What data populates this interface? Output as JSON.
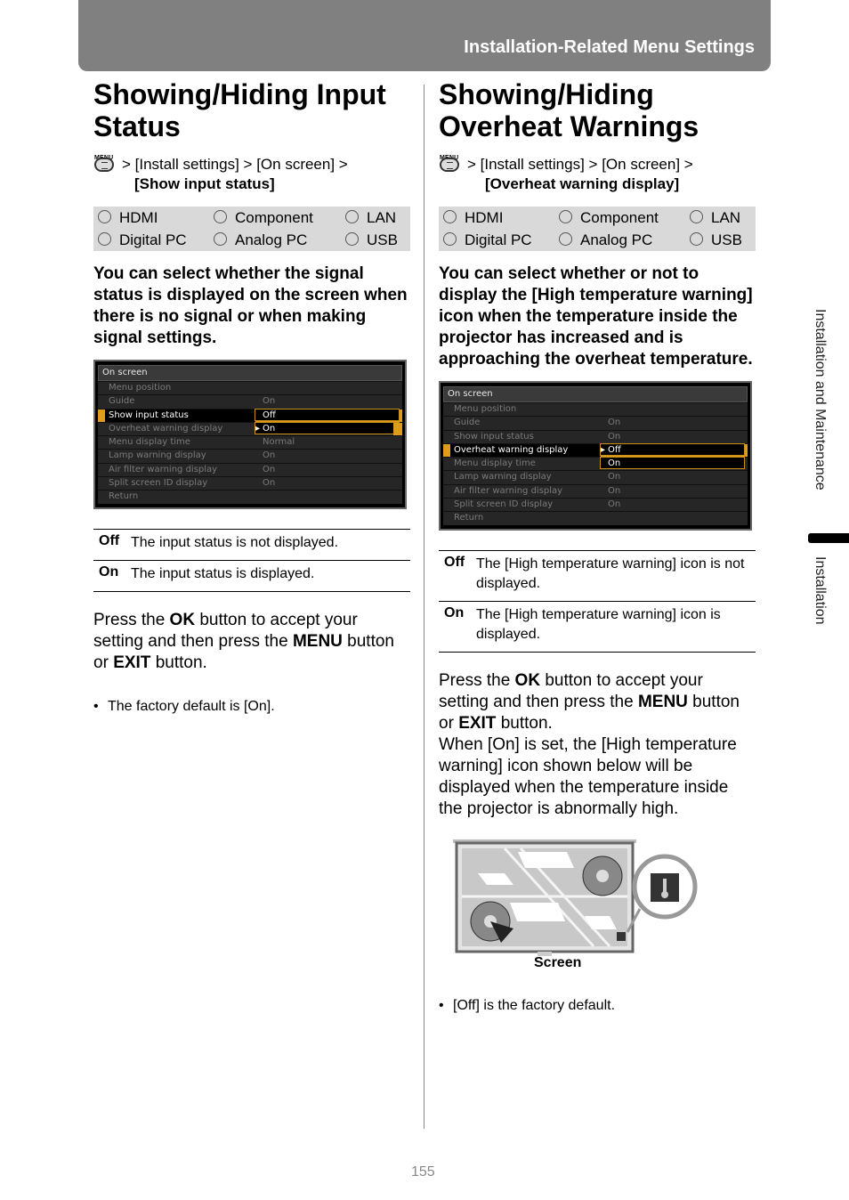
{
  "header": {
    "title": "Installation-Related Menu Settings"
  },
  "side_tabs": {
    "section": "Installation and Maintenance",
    "current": "Installation"
  },
  "page_number": "155",
  "left": {
    "title": "Showing/Hiding Input Status",
    "path_prefix": "> [Install settings] > [On screen] >",
    "path_target": "[Show input status]",
    "menu_icon_label": "MENU",
    "inputs": [
      "HDMI",
      "Component",
      "LAN",
      "Digital PC",
      "Analog PC",
      "USB"
    ],
    "lead": "You can select whether the signal status is displayed on the screen when there is no signal or when making signal settings.",
    "osd": {
      "title": "On screen",
      "rows": [
        {
          "name": "Menu position",
          "value": ""
        },
        {
          "name": "Guide",
          "value": "On"
        },
        {
          "name": "Show input status",
          "value": "Off"
        },
        {
          "name": "Overheat warning display",
          "value": "On"
        },
        {
          "name": "Menu display time",
          "value": "Normal"
        },
        {
          "name": "Lamp warning display",
          "value": "On"
        },
        {
          "name": "Air filter warning display",
          "value": "On"
        },
        {
          "name": "Split screen ID display",
          "value": "On"
        },
        {
          "name": "Return",
          "value": ""
        }
      ],
      "selected_item": "Show input status",
      "popup_options": [
        "Off",
        "On"
      ],
      "popup_cursor": "On"
    },
    "options": [
      {
        "key": "Off",
        "desc": "The input status is not displayed."
      },
      {
        "key": "On",
        "desc": "The input status is displayed."
      }
    ],
    "instruction": {
      "p1": "Press the ",
      "ok": "OK",
      "p2": " button to accept your setting and then press the ",
      "menu": "MENU",
      "p3": " button or ",
      "exit": "EXIT",
      "p4": " button."
    },
    "note": "The factory default is [On]."
  },
  "right": {
    "title": "Showing/Hiding Overheat Warnings",
    "path_prefix": "> [Install settings] > [On screen] >",
    "path_target": "[Overheat warning display]",
    "menu_icon_label": "MENU",
    "inputs": [
      "HDMI",
      "Component",
      "LAN",
      "Digital PC",
      "Analog PC",
      "USB"
    ],
    "lead": "You can select whether or not to display the [High temperature warning] icon when the temperature inside the projector has increased and is approaching the overheat temperature.",
    "osd": {
      "title": "On screen",
      "rows": [
        {
          "name": "Menu position",
          "value": ""
        },
        {
          "name": "Guide",
          "value": "On"
        },
        {
          "name": "Show input status",
          "value": "On"
        },
        {
          "name": "Overheat warning display",
          "value": "Off"
        },
        {
          "name": "Menu display time",
          "value": "On"
        },
        {
          "name": "Lamp warning display",
          "value": "On"
        },
        {
          "name": "Air filter warning display",
          "value": "On"
        },
        {
          "name": "Split screen ID display",
          "value": "On"
        },
        {
          "name": "Return",
          "value": ""
        }
      ],
      "selected_item": "Overheat warning display",
      "popup_options": [
        "Off",
        "On"
      ],
      "popup_cursor": "Off"
    },
    "options": [
      {
        "key": "Off",
        "desc": "The [High temperature warning] icon is not displayed."
      },
      {
        "key": "On",
        "desc": "The [High temperature warning] icon is displayed."
      }
    ],
    "instruction": {
      "p1": "Press the ",
      "ok": "OK",
      "p2": " button to accept your setting and then press the ",
      "menu": "MENU",
      "p3": " button or ",
      "exit": "EXIT",
      "p4": " button."
    },
    "extra": "When [On] is set, the [High temperature warning] icon shown below will be displayed when the temperature inside the projector is abnormally high.",
    "illustration_caption": "Screen",
    "illustration_icon": "thermometer-warning-icon",
    "note": "[Off] is the factory default."
  }
}
